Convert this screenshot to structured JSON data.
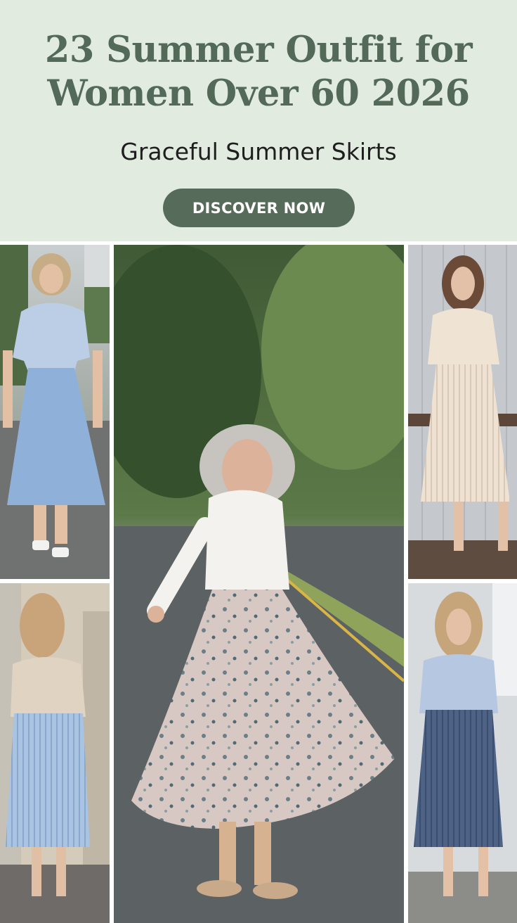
{
  "header": {
    "title_line1": "23 Summer Outfit for",
    "title_line2": "Women Over 60 2026",
    "subtitle": "Graceful Summer Skirts",
    "cta_label": "DISCOVER NOW"
  },
  "colors": {
    "header_bg": "#e2ebdf",
    "title": "#536a59",
    "cta_bg": "#576b5a",
    "cta_text": "#ffffff"
  },
  "photos": [
    {
      "name": "photo-blue-shirt-blue-skirt",
      "description": "woman in light blue shirt and flared blue midi skirt"
    },
    {
      "name": "photo-white-blouse-floral-skirt",
      "description": "woman twirling in white blouse and floral midi skirt"
    },
    {
      "name": "photo-cream-cardigan-pleated-skirt",
      "description": "woman in cream top and pleated cream midi skirt"
    },
    {
      "name": "photo-beige-top-pleated-blue-skirt",
      "description": "woman in beige top and pleated light blue skirt"
    },
    {
      "name": "photo-blue-shirt-navy-pleated-skirt",
      "description": "woman in light blue shirt and navy pleated skirt"
    }
  ]
}
